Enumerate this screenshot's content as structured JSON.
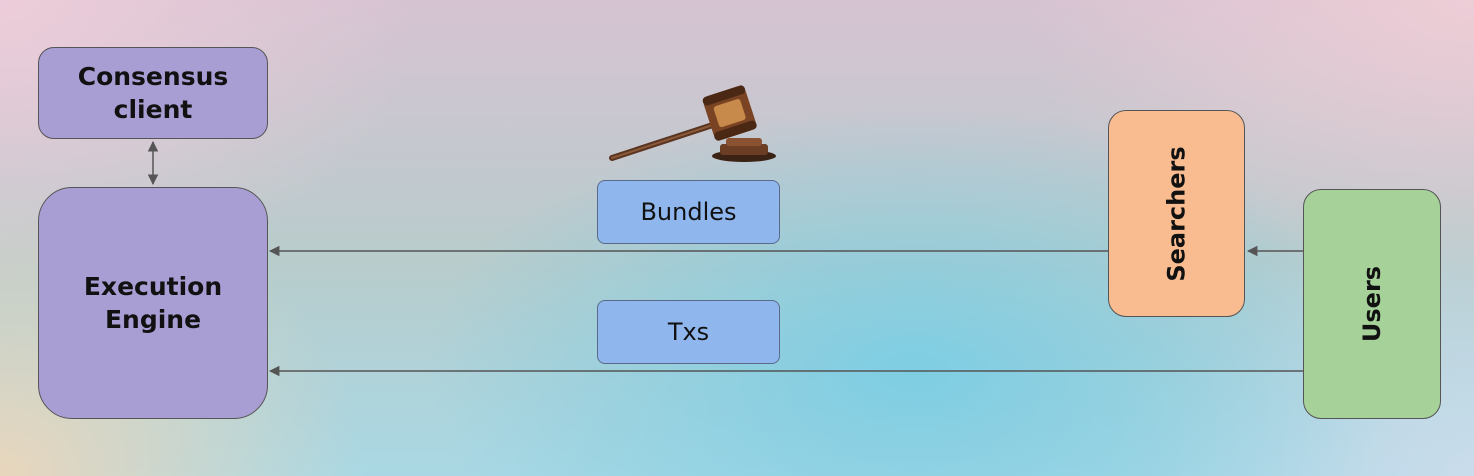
{
  "nodes": {
    "consensus_client": "Consensus client",
    "execution_engine": "Execution Engine",
    "bundles": "Bundles",
    "txs": "Txs",
    "searchers": "Searchers",
    "users": "Users"
  },
  "icons": {
    "auction": "gavel-icon"
  },
  "edges": [
    {
      "from": "consensus_client",
      "to": "execution_engine",
      "direction": "both"
    },
    {
      "from": "searchers",
      "to": "execution_engine",
      "label": "Bundles"
    },
    {
      "from": "users",
      "to": "searchers"
    },
    {
      "from": "users",
      "to": "execution_engine",
      "label": "Txs"
    }
  ],
  "colors": {
    "purple": "#a99ed4",
    "blue": "#8fb7ee",
    "orange": "#f9bc90",
    "green": "#a6d29a"
  }
}
